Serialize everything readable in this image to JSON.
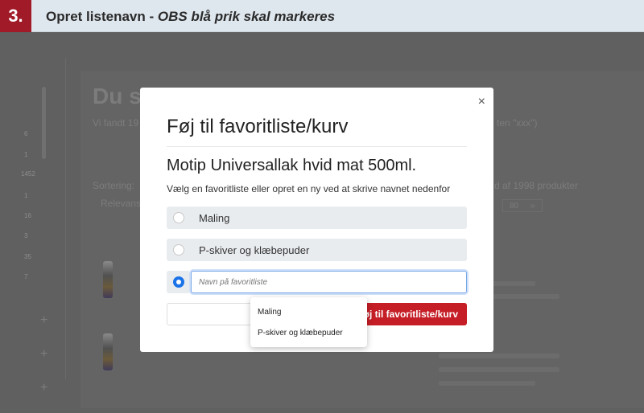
{
  "banner": {
    "step": "3.",
    "title": "Opret listenavn",
    "separator": " - ",
    "note": "OBS blå prik skal markeres"
  },
  "background": {
    "heading": "Du s",
    "subtitle": "Vi fandt 19",
    "subtitle_right": "ten \"xxx\")",
    "sort_label": "Sortering:",
    "sort_value": "Relevans",
    "count_text": "d af 1998 produkter",
    "pager_value": "80",
    "pager_next": "»",
    "sidebar_numbers": [
      "6",
      "1",
      "1452",
      "1",
      "16",
      "3",
      "35",
      "7"
    ]
  },
  "modal": {
    "close_symbol": "×",
    "title": "Føj til favoritliste/kurv",
    "product_name": "Motip Universallak hvid mat 500ml.",
    "instruction": "Vælg en favoritliste eller opret en ny ved at skrive navnet nedenfor",
    "options": [
      {
        "label": "Maling",
        "selected": false
      },
      {
        "label": "P-skiver og klæbepuder",
        "selected": false
      }
    ],
    "new_list": {
      "placeholder": "Navn på favoritliste",
      "selected": true
    },
    "submit_label": "Føj til favoritliste/kurv"
  },
  "autocomplete": {
    "items": [
      "Maling",
      "P-skiver og klæbepuder"
    ]
  },
  "colors": {
    "badge": "#a01a28",
    "primary": "#c51e26",
    "radio_selected": "#1a73e8",
    "banner_bg": "#dfe7ee"
  }
}
